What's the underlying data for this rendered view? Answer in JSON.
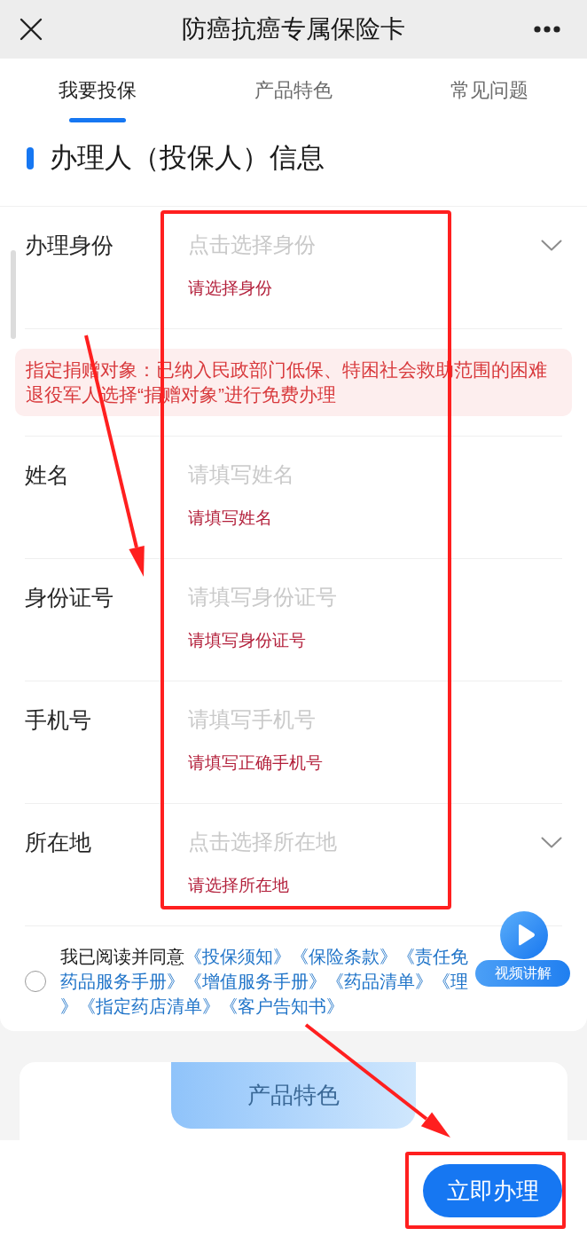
{
  "header": {
    "title": "防癌抗癌专属保险卡"
  },
  "tabs": [
    {
      "label": "我要投保",
      "selected": true
    },
    {
      "label": "产品特色",
      "selected": false
    },
    {
      "label": "常见问题",
      "selected": false
    }
  ],
  "section_title": "办理人（投保人）信息",
  "form": [
    {
      "kind": "select",
      "label": "办理身份",
      "placeholder": "点击选择身份",
      "error": "请选择身份"
    },
    {
      "kind": "notice",
      "text": "指定捐赠对象：已纳入民政部门低保、特困社会救助范围的困难退役军人选择“捐赠对象”进行免费办理"
    },
    {
      "kind": "input",
      "label": "姓名",
      "placeholder": "请填写姓名",
      "error": "请填写姓名"
    },
    {
      "kind": "input",
      "label": "身份证号",
      "placeholder": "请填写身份证号",
      "error": "请填写身份证号"
    },
    {
      "kind": "input",
      "label": "手机号",
      "placeholder": "请填写手机号",
      "error": "请填写正确手机号"
    },
    {
      "kind": "select",
      "label": "所在地",
      "placeholder": "点击选择所在地",
      "error": "请选择所在地"
    }
  ],
  "agreement": {
    "checked": false,
    "intro": "我已阅读并同意",
    "lines": [
      [
        "《投保须知》",
        "《保险条款》",
        "《责任免"
      ],
      [
        "药品服务手册》",
        "《增值服务手册》",
        "《药品清单》",
        "《理"
      ],
      [
        "》",
        "《指定药店清单》",
        "《客户告知书》"
      ]
    ]
  },
  "video_button": {
    "label": "视频讲解"
  },
  "features_card": {
    "title": "产品特色"
  },
  "submit_button": {
    "label": "立即办理"
  }
}
